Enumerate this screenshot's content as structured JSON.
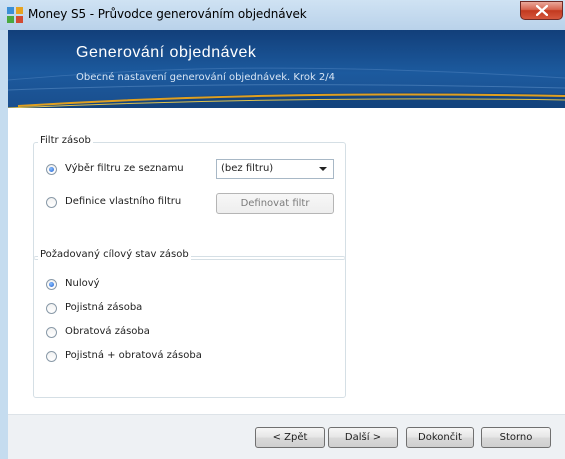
{
  "window": {
    "title": "Money S5 - Průvodce generováním objednávek"
  },
  "banner": {
    "title": "Generování objednávek",
    "subtitle": "Obecné nastavení generování objednávek. Krok 2/4"
  },
  "filter_group": {
    "label": "Filtr zásob",
    "options": [
      {
        "label": "Výběr filtru ze seznamu",
        "checked": true
      },
      {
        "label": "Definice vlastního filtru",
        "checked": false
      }
    ],
    "select_value": "(bez filtru)",
    "define_button": "Definovat filtr"
  },
  "target_group": {
    "label": "Požadovaný cílový stav zásob",
    "options": [
      {
        "label": "Nulový",
        "checked": true
      },
      {
        "label": "Pojistná zásoba",
        "checked": false
      },
      {
        "label": "Obratová zásoba",
        "checked": false
      },
      {
        "label": "Pojistná + obratová zásoba",
        "checked": false
      }
    ]
  },
  "footer": {
    "back": "< Zpět",
    "next": "Další >",
    "finish": "Dokončit",
    "cancel": "Storno"
  }
}
